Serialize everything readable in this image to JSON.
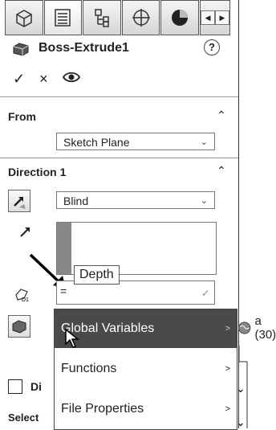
{
  "header": {
    "feature_name": "Boss-Extrude1",
    "help": "?",
    "tab_icons": [
      "feature-manager-icon",
      "property-manager-icon",
      "configuration-manager-icon",
      "dimxpert-icon",
      "display-manager-icon"
    ]
  },
  "actions": {
    "ok": "✓",
    "cancel": "×",
    "preview": "👁"
  },
  "from": {
    "title": "From",
    "value": "Sketch Plane"
  },
  "direction1": {
    "title": "Direction 1",
    "end_condition": "Blind"
  },
  "depth": {
    "tooltip": "Depth",
    "value": "="
  },
  "context_menu": {
    "items": [
      "Global Variables",
      "Functions",
      "File Properties"
    ],
    "submenu_item": "a (30)"
  },
  "truncated_labels": {
    "direction2": "Di",
    "selected": "Select"
  }
}
